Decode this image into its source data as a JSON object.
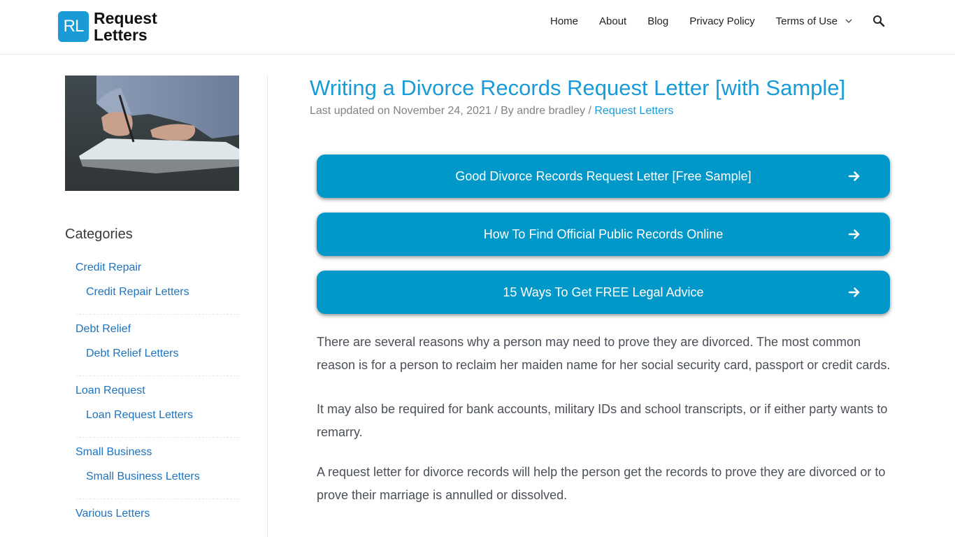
{
  "header": {
    "logo": {
      "mark": "RL",
      "line1": "Request",
      "line2": "Letters"
    },
    "nav": [
      {
        "label": "Home"
      },
      {
        "label": "About"
      },
      {
        "label": "Blog"
      },
      {
        "label": "Privacy Policy"
      },
      {
        "label": "Terms of Use",
        "has_dropdown": true
      }
    ],
    "search_icon": "search-icon"
  },
  "sidebar": {
    "image_alt": "Person writing on paper with a pen",
    "widget_title": "Categories",
    "categories": [
      {
        "label": "Credit Repair",
        "child": "Credit Repair Letters"
      },
      {
        "label": "Debt Relief",
        "child": "Debt Relief Letters"
      },
      {
        "label": "Loan Request",
        "child": "Loan Request Letters"
      },
      {
        "label": "Small Business",
        "child": "Small Business Letters"
      },
      {
        "label": "Various Letters"
      }
    ]
  },
  "article": {
    "title": "Writing a Divorce Records Request Letter [with Sample]",
    "meta": {
      "prefix": "Last updated on November 24, 2021 / By andre bradley / ",
      "category": "Request Letters"
    },
    "cta_buttons": [
      {
        "label": "Good Divorce Records Request Letter [Free Sample]",
        "icon": "arrow-right-icon"
      },
      {
        "label": "How To Find Official Public Records Online",
        "icon": "arrow-right-icon"
      },
      {
        "label": "15 Ways To Get FREE Legal Advice",
        "icon": "arrow-right-icon"
      }
    ],
    "paragraphs": [
      "There are several reasons why a person may need to prove they are divorced. The most common reason is for a person to reclaim her maiden name for her social security card, passport or credit cards.",
      "It may also be required for bank accounts, military IDs and school transcripts, or if either party wants to remarry.",
      "A request letter for divorce records will help the person get the records to prove they are divorced or to prove their marriage is annulled or dissolved."
    ]
  },
  "colors": {
    "accent": "#1a9bd7",
    "cta_bg": "#0098c9",
    "link": "#1e73be",
    "text": "#4b4f58",
    "meta": "#808285"
  }
}
